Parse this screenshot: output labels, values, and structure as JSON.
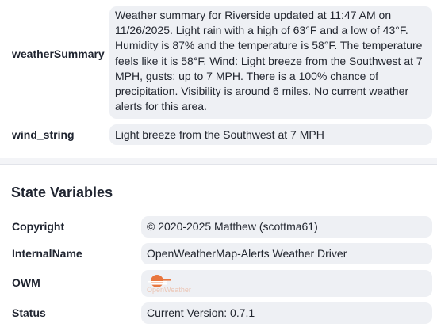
{
  "attributes": {
    "weatherSummary": {
      "label": "weatherSummary",
      "value": "Weather summary for Riverside updated at 11:47 AM on 11/26/2025. Light rain with a high of 63°F and a low of 43°F. Humidity is 87% and the temperature is 58°F. The temperature feels like it is 58°F. Wind: Light breeze from the Southwest at 7 MPH, gusts: up to 7 MPH. There is a 100% chance of precipitation. Visibility is around 6 miles. No current weather alerts for this area."
    },
    "wind_string": {
      "label": "wind_string",
      "value": "Light breeze from the Southwest at 7 MPH"
    }
  },
  "state_variables": {
    "title": "State Variables",
    "copyright": {
      "label": "Copyright",
      "value": "© 2020-2025 Matthew (scottma61)"
    },
    "internal_name": {
      "label": "InternalName",
      "value": "OpenWeatherMap-Alerts Weather Driver"
    },
    "owm": {
      "label": "OWM",
      "logo_text": "OpenWeather",
      "logo_color": "#e8763e"
    },
    "status": {
      "label": "Status",
      "value": "Current Version: 0.7.1"
    }
  }
}
